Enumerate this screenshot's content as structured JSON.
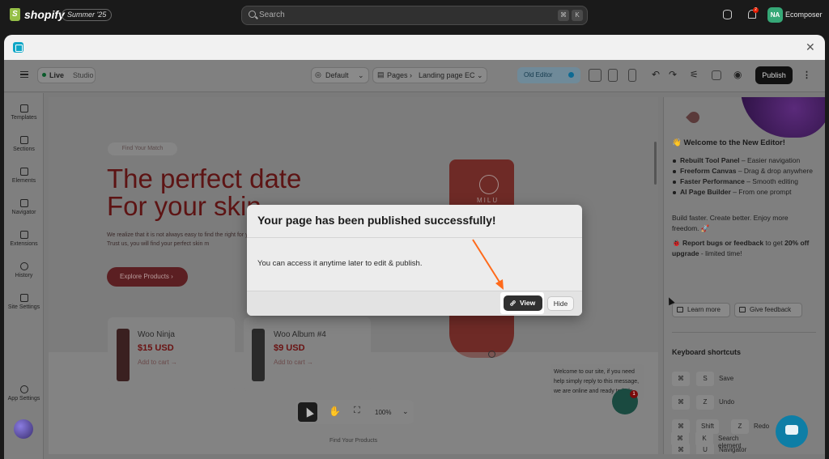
{
  "shopify_bar": {
    "logo_text": "shopify",
    "edition_badge": "Summer '25",
    "search_placeholder": "Search",
    "shortcut_keys": [
      "⌘",
      "K"
    ],
    "notification_count": "2",
    "avatar_initials": "NA",
    "store_name": "Ecomposer"
  },
  "editor_toolbar": {
    "status": "Live",
    "studio_label": "Studio",
    "device_preset": "Default",
    "breadcrumb_section": "Pages",
    "breadcrumb_page": "Landing page EC",
    "old_editor_label": "Old Editor",
    "publish_label": "Publish"
  },
  "left_rail": {
    "items": [
      {
        "label": "Templates",
        "icon": "templates-icon"
      },
      {
        "label": "Sections",
        "icon": "sections-icon"
      },
      {
        "label": "Elements",
        "icon": "elements-icon"
      },
      {
        "label": "Navigator",
        "icon": "navigator-icon"
      },
      {
        "label": "Extensions",
        "icon": "extensions-icon"
      },
      {
        "label": "History",
        "icon": "history-icon"
      },
      {
        "label": "Site Settings",
        "icon": "site-settings-icon"
      }
    ],
    "app_settings_label": "App Settings"
  },
  "canvas": {
    "pill_text": "Find Your Match",
    "hero_line1": "The perfect date",
    "hero_line2": "For your skin",
    "hero_desc": "We realize that it is not always easy to find the right for you! Trust us, you will find your perfect skin m",
    "cta_label": "Explore Products",
    "product_brand": "MILU",
    "products": [
      {
        "name": "Woo Ninja",
        "price": "$15 USD",
        "cart": "Add to cart →"
      },
      {
        "name": "Woo Album #4",
        "price": "$9 USD",
        "cart": "Add to cart →"
      }
    ],
    "chat_message": "Welcome to our site, if you need help simply reply to this message, we are online and ready to help.",
    "zoom_level": "100%",
    "footer_text": "Find Your Products",
    "chat_badge": "1"
  },
  "right_panel": {
    "welcome_title": "👋 Welcome to the New Editor!",
    "features": [
      {
        "bold": "Rebuilt Tool Panel",
        "rest": " – Easier navigation"
      },
      {
        "bold": "Freeform Canvas",
        "rest": " – Drag & drop anywhere"
      },
      {
        "bold": "Faster Performance",
        "rest": " – Smooth editing"
      },
      {
        "bold": "AI Page Builder",
        "rest": " – From one prompt"
      }
    ],
    "tagline": "Build faster. Create better. Enjoy more freedom. 🚀",
    "report_prefix": "🐞 ",
    "report_bold": "Report bugs or feedback",
    "report_mid": " to get ",
    "report_bold2": "20% off upgrade",
    "report_suffix": " - limited time!",
    "learn_more_label": "Learn more",
    "give_feedback_label": "Give feedback",
    "shortcuts_title": "Keyboard shortcuts",
    "shortcuts": [
      {
        "keys": [
          "⌘",
          "S"
        ],
        "label": "Save"
      },
      {
        "keys": [
          "⌘",
          "Z"
        ],
        "label": "Undo"
      },
      {
        "keys": [
          "⌘",
          "Shift",
          "Z"
        ],
        "label": "Redo"
      },
      {
        "keys": [
          "⌘",
          "U"
        ],
        "label": "Navigator"
      },
      {
        "keys": [
          "⌘",
          "K"
        ],
        "label": "Search element"
      }
    ]
  },
  "modal": {
    "title": "Your page has been published successfully!",
    "body": "You can access it anytime later to edit & publish.",
    "view_label": "View",
    "hide_label": "Hide"
  },
  "colors": {
    "accent_arrow": "#ff6a1a",
    "primary_button": "#303030",
    "live_green": "#36a877",
    "brand_red": "#6a1212"
  }
}
